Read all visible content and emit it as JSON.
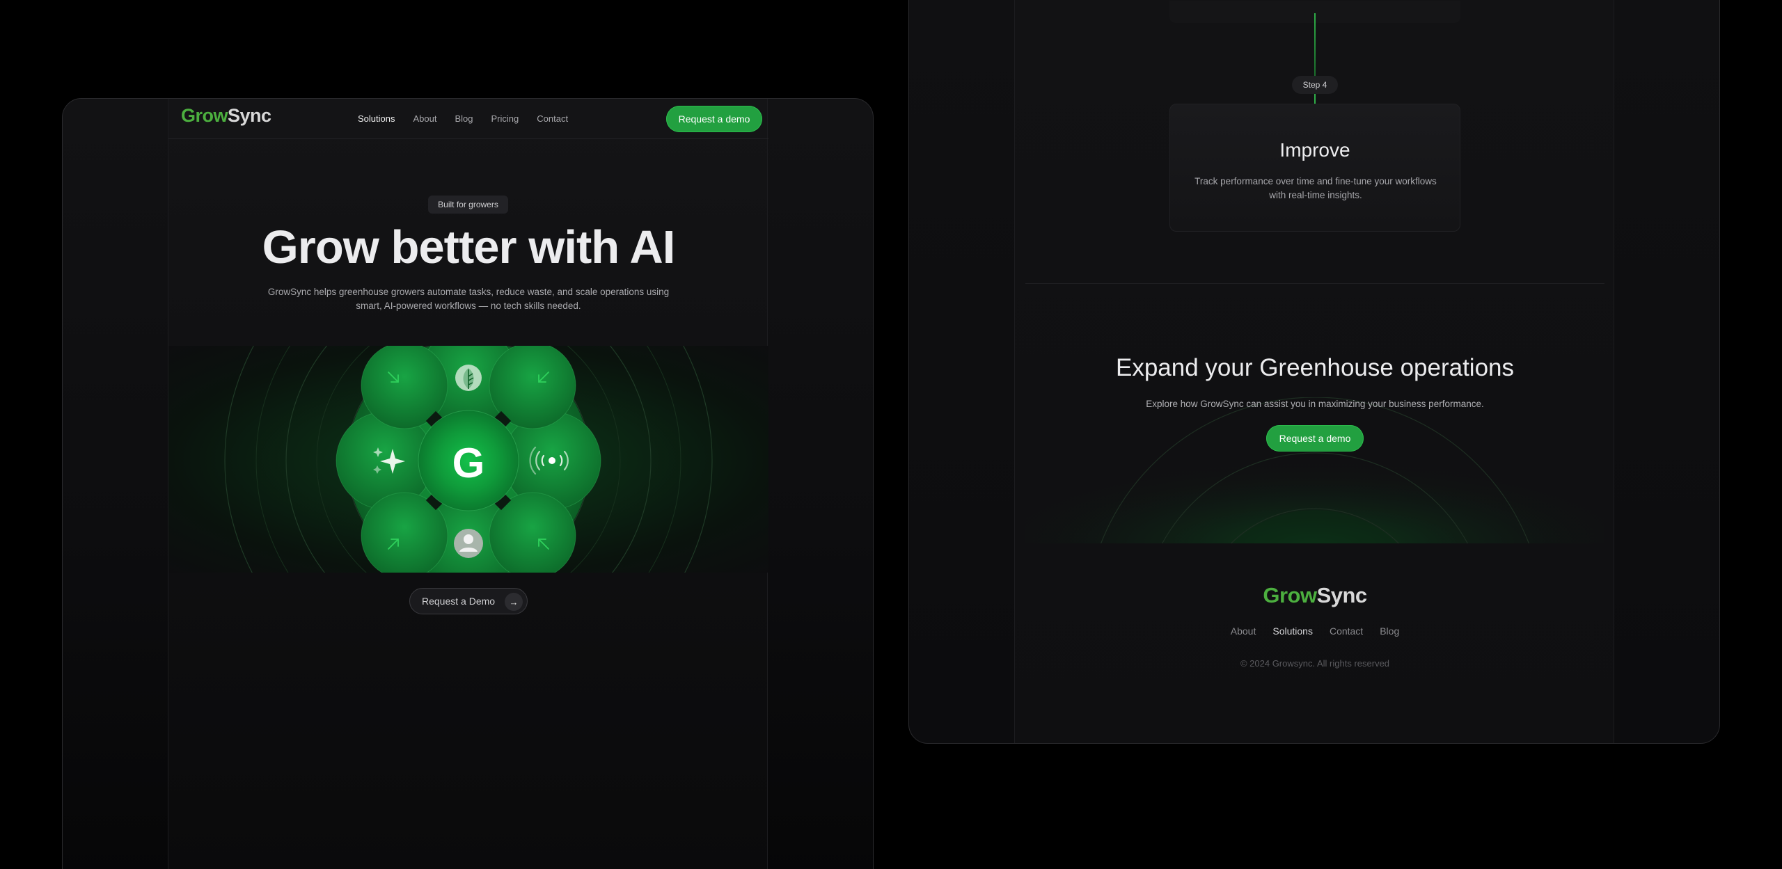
{
  "left_page": {
    "brand": {
      "part1": "Grow",
      "part2": "Sync"
    },
    "nav": {
      "items": [
        {
          "label": "Solutions",
          "active": true
        },
        {
          "label": "About",
          "active": false
        },
        {
          "label": "Blog",
          "active": false
        },
        {
          "label": "Pricing",
          "active": false
        },
        {
          "label": "Contact",
          "active": false
        }
      ],
      "cta_label": "Request a demo"
    },
    "hero": {
      "badge": "Built for growers",
      "title": "Grow better with AI",
      "subtitle": "GrowSync helps greenhouse growers automate tasks, reduce waste, and scale operations using smart, AI-powered workflows — no tech skills needed.",
      "center_letter": "G",
      "demo_button": "Request a Demo"
    }
  },
  "right_page": {
    "step": {
      "badge": "Step 4",
      "title": "Improve",
      "description": "Track performance over time and fine-tune your workflows with real-time insights."
    },
    "cta": {
      "title": "Expand your Greenhouse operations",
      "subtitle": "Explore how GrowSync can assist you in maximizing your business performance.",
      "button": "Request a demo"
    },
    "footer": {
      "brand": {
        "part1": "Grow",
        "part2": "Sync"
      },
      "links": [
        {
          "label": "About",
          "active": false
        },
        {
          "label": "Solutions",
          "active": true
        },
        {
          "label": "Contact",
          "active": false
        },
        {
          "label": "Blog",
          "active": false
        }
      ],
      "copyright": "© 2024 Growsync. All rights reserved"
    }
  },
  "colors": {
    "accent_green": "#22a040",
    "brand_green": "#4caf3f",
    "background": "#000000"
  },
  "icons": [
    "leaf-icon",
    "sparkle-icon",
    "signal-icon",
    "user-icon",
    "arrow-right-icon",
    "diagonal-arrow-icon"
  ]
}
